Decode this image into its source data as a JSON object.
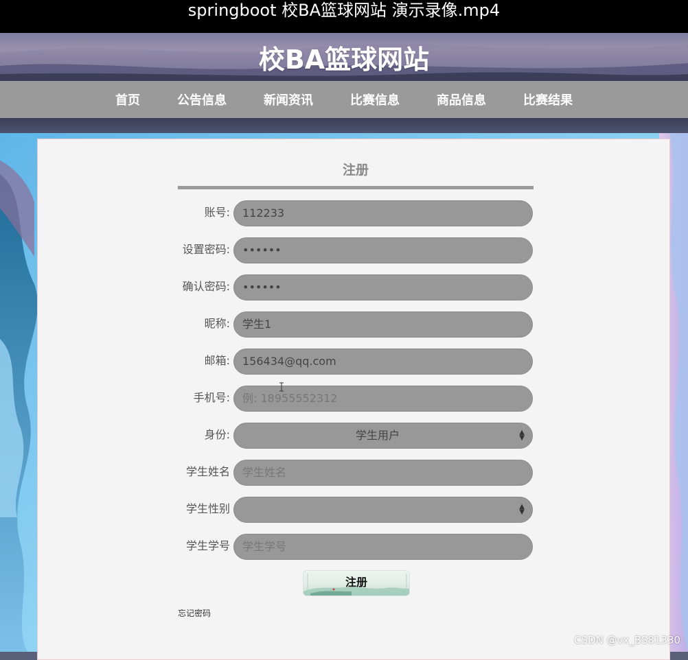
{
  "video": {
    "title": "springboot 校BA篮球网站 演示录像.mp4"
  },
  "site": {
    "title": "校BA篮球网站"
  },
  "nav": {
    "items": [
      {
        "label": "首页"
      },
      {
        "label": "公告信息"
      },
      {
        "label": "新闻资讯"
      },
      {
        "label": "比赛信息"
      },
      {
        "label": "商品信息"
      },
      {
        "label": "比赛结果"
      }
    ]
  },
  "form": {
    "title": "注册",
    "fields": {
      "account": {
        "label": "账号:",
        "value": "112233"
      },
      "password": {
        "label": "设置密码:",
        "value": "••••••"
      },
      "confirm_password": {
        "label": "确认密码:",
        "value": "••••••"
      },
      "nickname": {
        "label": "昵称:",
        "value": "学生1"
      },
      "email": {
        "label": "邮箱:",
        "value": "156434@qq.com"
      },
      "phone": {
        "label": "手机号:",
        "placeholder": "例: 18955552312"
      },
      "role": {
        "label": "身份:",
        "selected": "学生用户"
      },
      "student_name": {
        "label": "学生姓名",
        "placeholder": "学生姓名"
      },
      "student_gender": {
        "label": "学生性别",
        "selected": ""
      },
      "student_id": {
        "label": "学生学号",
        "placeholder": "学生学号"
      }
    },
    "submit_label": "注册",
    "forgot_label": "忘记密码"
  },
  "watermark": "CSDN @vx_BS81330"
}
